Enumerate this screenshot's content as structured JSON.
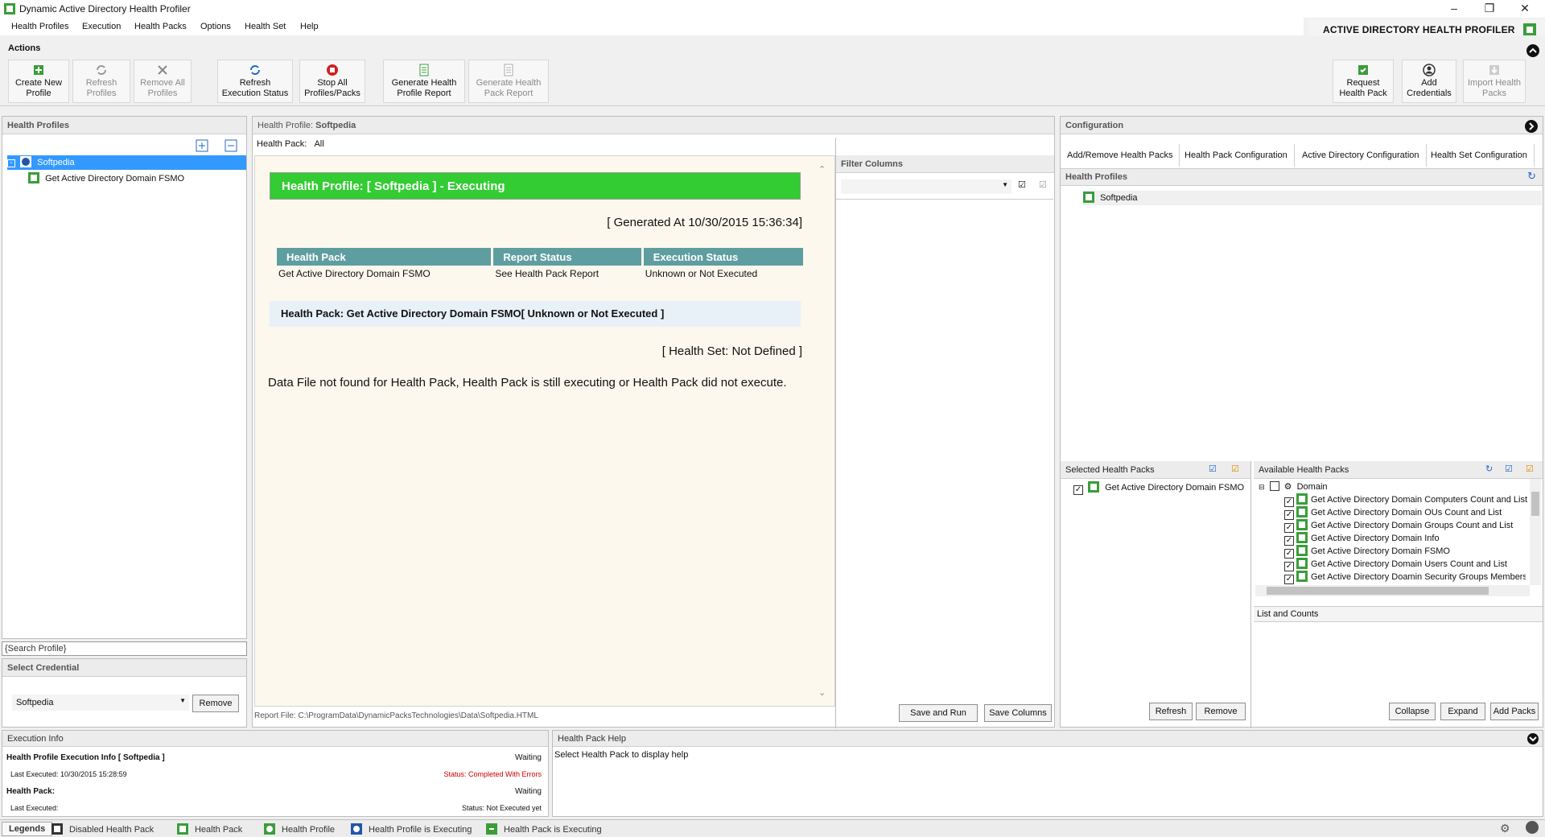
{
  "window": {
    "title": "Dynamic Active Directory Health Profiler",
    "brand": "ACTIVE DIRECTORY HEALTH PROFILER"
  },
  "menu": [
    "Health Profiles",
    "Execution",
    "Health Packs",
    "Options",
    "Health Set",
    "Help"
  ],
  "ribbon": {
    "title": "Actions",
    "buttons": [
      {
        "label": "Create New Profile",
        "disabled": false
      },
      {
        "label": "Refresh Profiles",
        "disabled": true
      },
      {
        "label": "Remove All Profiles",
        "disabled": true
      },
      {
        "label": "Refresh Execution Status",
        "disabled": false
      },
      {
        "label": "Stop All Profiles/Packs",
        "disabled": false
      },
      {
        "label": "Generate Health Profile Report",
        "disabled": false
      },
      {
        "label": "Generate Health Pack Report",
        "disabled": true
      },
      {
        "label": "Request Health Pack",
        "disabled": false
      },
      {
        "label": "Add Credentials",
        "disabled": false
      },
      {
        "label": "Import Health Packs",
        "disabled": true
      }
    ]
  },
  "left": {
    "header": "Health Profiles",
    "tree": [
      {
        "label": "Softpedia",
        "selected": true
      },
      {
        "label": "Get Active Directory Domain FSMO",
        "selected": false
      }
    ],
    "search_placeholder": "{Search Profile}",
    "credential_header": "Select Credential",
    "credential_value": "Softpedia",
    "remove_label": "Remove"
  },
  "center": {
    "profile_label": "Health Profile:",
    "profile_value": "Softpedia",
    "pack_label": "Health Pack:",
    "pack_value": "All",
    "report": {
      "banner": "Health Profile: [ Softpedia ] - Executing",
      "generated": "[ Generated At 10/30/2015 15:36:34]",
      "columns": [
        "Health Pack",
        "Report Status",
        "Execution Status"
      ],
      "rows": [
        [
          "Get Active Directory Domain FSMO",
          "See Health Pack Report",
          "Unknown or Not Executed"
        ]
      ],
      "pack_line": "Health Pack: Get Active Directory Domain FSMO[ Unknown or Not Executed ]",
      "health_set": "[ Health Set: Not Defined ]",
      "message": "Data File not found for Health Pack, Health Pack is still executing or Health Pack did not execute."
    },
    "report_file": "Report File: C:\\ProgramData\\DynamicPacksTechnologies\\Data\\Softpedia.HTML"
  },
  "filter": {
    "header": "Filter Columns",
    "save_run": "Save and Run",
    "save_columns": "Save Columns"
  },
  "config": {
    "header": "Configuration",
    "tabs": [
      "Add/Remove Health Packs",
      "Health Pack Configuration",
      "Active Directory Configuration",
      "Health Set Configuration"
    ],
    "profiles_header": "Health Profiles",
    "profiles": [
      "Softpedia"
    ],
    "selected_header": "Selected Health Packs",
    "selected": [
      "Get Active Directory Domain FSMO"
    ],
    "available_header": "Available Health Packs",
    "available_root": "Domain",
    "available": [
      "Get Active Directory Domain Computers Count and List",
      "Get Active Directory Domain OUs Count and List",
      "Get Active Directory Domain Groups Count and List",
      "Get Active Directory Domain Info",
      "Get Active Directory Domain FSMO",
      "Get Active Directory Domain Users Count and List",
      "Get Active Directory Doamin Security Groups Membership"
    ],
    "list_counts": "List and Counts",
    "refresh": "Refresh",
    "remove": "Remove",
    "collapse": "Collapse",
    "expand": "Expand",
    "add_packs": "Add Packs"
  },
  "exec_info": {
    "header": "Execution Info",
    "line1_label": "Health Profile Execution Info [ Softpedia ]",
    "line1_status": "Waiting",
    "line2_label": "Last Executed: 10/30/2015 15:28:59",
    "line2_status": "Status: Completed With Errors",
    "line3_label": "Health Pack:",
    "line3_status": "Waiting",
    "line4_label": "Last Executed:",
    "line4_status": "Status: Not Executed yet"
  },
  "help": {
    "header": "Health Pack Help",
    "text": "Select Health Pack to display help"
  },
  "legends": {
    "title": "Legends",
    "items": [
      "Disabled Health Pack",
      "Health Pack",
      "Health Profile",
      "Health Profile is Executing",
      "Health Pack is Executing"
    ]
  },
  "colors": {
    "accent_green": "#33cc33",
    "table_header": "#5f9ea0",
    "selection": "#3399ff",
    "error_red": "#cc0000"
  }
}
